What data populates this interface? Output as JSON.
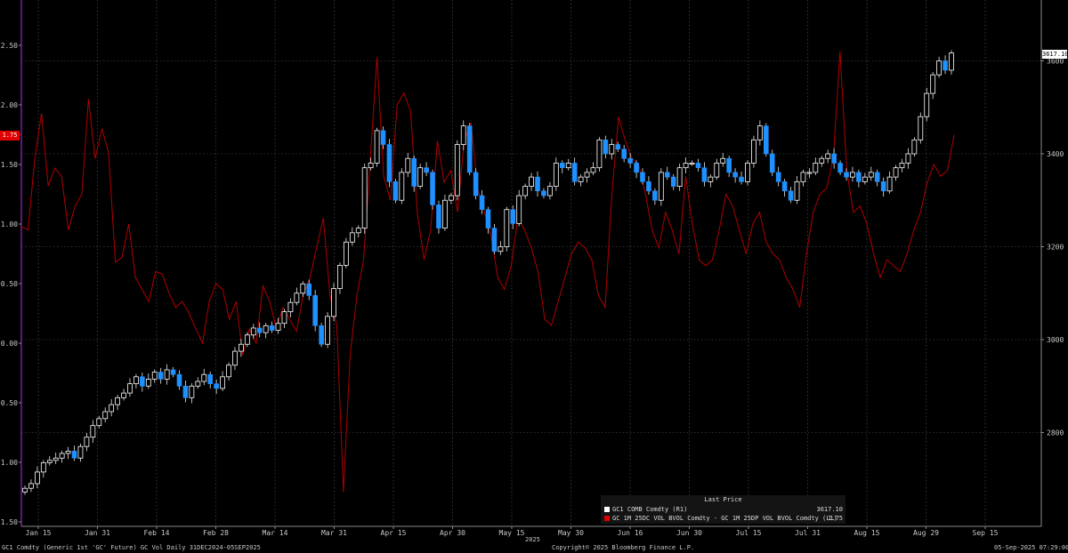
{
  "chart_data": {
    "type": "candlestick+line",
    "left_axis": {
      "ticks": [
        "2.50",
        "2.00",
        "1.50",
        "1.00",
        "0.50",
        "0.00",
        "-0.50",
        "-1.00",
        "-1.50"
      ],
      "ylim": [
        -1.5,
        2.5
      ]
    },
    "right_axis": {
      "ticks": [
        "3600",
        "3400",
        "3200",
        "3000",
        "2800"
      ],
      "ylim": [
        2650,
        3680
      ]
    },
    "x_ticks": [
      "Jan 15",
      "Jan 31",
      "Feb 14",
      "Feb 28",
      "Mar 14",
      "Mar 31",
      "Apr 15",
      "Apr 30",
      "May 15",
      "May 30",
      "Jun 16",
      "Jun 30",
      "Jul 15",
      "Jul 31",
      "Aug 15",
      "Aug 29",
      "Sep 15"
    ],
    "x_year": "2025",
    "candles_series": {
      "name": "GC1 COMB Comdty  (R1)",
      "last_value": "3617.10",
      "color": "#ffffff",
      "down_color": "#1e90ff",
      "closes": [
        2680,
        2690,
        2715,
        2735,
        2740,
        2745,
        2755,
        2760,
        2745,
        2770,
        2790,
        2815,
        2830,
        2845,
        2860,
        2875,
        2885,
        2905,
        2920,
        2900,
        2915,
        2930,
        2915,
        2935,
        2925,
        2900,
        2875,
        2900,
        2910,
        2925,
        2905,
        2895,
        2920,
        2945,
        2975,
        2990,
        3010,
        3025,
        3015,
        3030,
        3020,
        3035,
        3060,
        3080,
        3100,
        3120,
        3095,
        3030,
        2990,
        3050,
        3110,
        3160,
        3210,
        3230,
        3240,
        3370,
        3380,
        3450,
        3420,
        3340,
        3300,
        3360,
        3390,
        3330,
        3370,
        3360,
        3290,
        3240,
        3300,
        3310,
        3420,
        3460,
        3360,
        3310,
        3280,
        3240,
        3190,
        3200,
        3280,
        3250,
        3310,
        3330,
        3350,
        3320,
        3310,
        3330,
        3380,
        3370,
        3380,
        3340,
        3350,
        3360,
        3370,
        3430,
        3400,
        3420,
        3410,
        3390,
        3380,
        3360,
        3340,
        3320,
        3300,
        3360,
        3350,
        3330,
        3370,
        3380,
        3380,
        3370,
        3340,
        3350,
        3380,
        3390,
        3360,
        3350,
        3340,
        3380,
        3430,
        3460,
        3400,
        3360,
        3340,
        3320,
        3300,
        3340,
        3360,
        3360,
        3380,
        3390,
        3400,
        3380,
        3360,
        3350,
        3360,
        3340,
        3350,
        3360,
        3340,
        3320,
        3350,
        3370,
        3380,
        3400,
        3430,
        3480,
        3530,
        3570,
        3600,
        3580,
        3617
      ]
    },
    "line_series": {
      "name": "GC 1M 25DC VOL BVOL Comdty - GC 1M 25DP VOL BVOL Comdty  (L1)",
      "last_value": "1.75",
      "color": "#b00000",
      "values": [
        0.98,
        0.95,
        1.55,
        1.93,
        1.32,
        1.47,
        1.4,
        0.95,
        1.15,
        1.25,
        2.05,
        1.55,
        1.8,
        1.6,
        0.68,
        0.72,
        1.0,
        0.55,
        0.45,
        0.35,
        0.6,
        0.58,
        0.42,
        0.3,
        0.35,
        0.25,
        0.12,
        0.0,
        0.35,
        0.5,
        0.45,
        0.2,
        0.35,
        -0.1,
        0.12,
        0.0,
        0.48,
        0.35,
        0.12,
        0.3,
        0.2,
        0.1,
        0.4,
        0.55,
        0.8,
        1.05,
        0.4,
        0.15,
        -1.25,
        -0.1,
        0.4,
        0.7,
        1.55,
        2.4,
        1.4,
        1.2,
        2.0,
        2.1,
        1.95,
        1.1,
        0.7,
        0.95,
        1.7,
        1.35,
        1.45,
        1.1,
        1.7,
        1.85,
        1.3,
        1.1,
        0.9,
        0.55,
        0.45,
        0.65,
        1.05,
        0.95,
        0.8,
        0.6,
        0.2,
        0.15,
        0.35,
        0.55,
        0.75,
        0.85,
        0.8,
        0.7,
        0.4,
        0.3,
        1.25,
        1.9,
        1.7,
        1.55,
        1.5,
        1.25,
        0.95,
        0.8,
        1.1,
        0.95,
        0.75,
        1.4,
        1.0,
        0.7,
        0.65,
        0.7,
        0.95,
        1.25,
        1.15,
        0.95,
        0.75,
        1.0,
        1.1,
        0.85,
        0.75,
        0.7,
        0.55,
        0.45,
        0.3,
        0.75,
        1.1,
        1.25,
        1.3,
        1.55,
        2.45,
        1.45,
        1.1,
        1.15,
        1.0,
        0.75,
        0.55,
        0.7,
        0.65,
        0.6,
        0.75,
        0.95,
        1.1,
        1.35,
        1.5,
        1.4,
        1.45,
        1.75
      ]
    }
  },
  "legend": {
    "header": "Last Price",
    "row1_label": "GC1 COMB Comdty  (R1)",
    "row1_value": "3617.10",
    "row2_label": "GC 1M 25DC VOL BVOL Comdty - GC 1M 25DP VOL BVOL Comdty  (L1)",
    "row2_value": "1.75"
  },
  "badges": {
    "left": "1.75",
    "right": "3617.10"
  },
  "footer": {
    "left": "GC1 Comdty (Generic 1st 'GC' Future) GC Vol  Daily 31DEC2024-05SEP2025",
    "center": "Copyright© 2025 Bloomberg Finance L.P.",
    "right": "05-Sep-2025 07:29:00"
  }
}
